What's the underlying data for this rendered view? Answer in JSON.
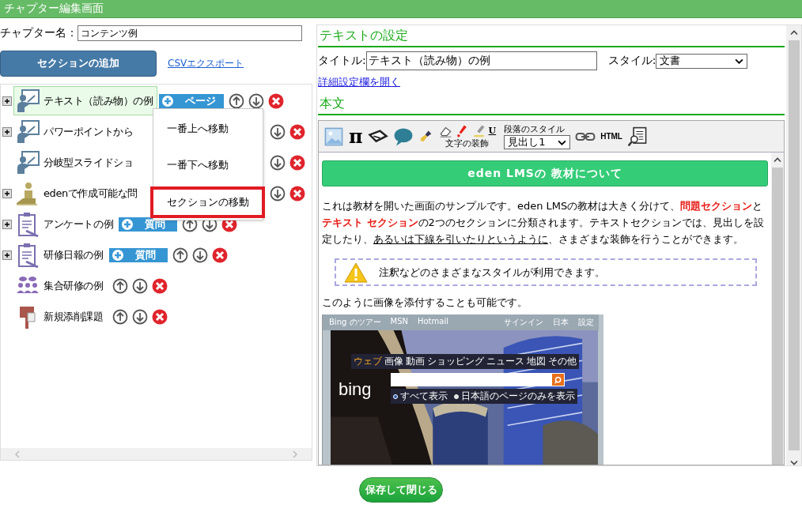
{
  "window": {
    "title": "チャプター編集画面"
  },
  "chapter_name": {
    "label": "チャプター名：",
    "value": "コンテンツ例"
  },
  "actions": {
    "add_button": "セクションの追加",
    "export_link": "CSVエクスポート"
  },
  "tree": {
    "items": [
      {
        "label": "テキスト（読み物）の例",
        "kind": "slide",
        "expandable": true,
        "selected": true,
        "covered": false,
        "add_button": "ページ"
      },
      {
        "label": "パワーポイントから",
        "kind": "slide",
        "expandable": true,
        "selected": false,
        "covered": true
      },
      {
        "label": "分岐型スライドショ",
        "kind": "slide",
        "expandable": false,
        "selected": false,
        "covered": true
      },
      {
        "label": "edenで作成可能な問",
        "kind": "quiz",
        "expandable": true,
        "selected": false,
        "covered": true
      },
      {
        "label": "アンケートの例",
        "kind": "survey",
        "expandable": true,
        "selected": false,
        "covered": false,
        "add_button": "質問"
      },
      {
        "label": "研修日報の例",
        "kind": "survey",
        "expandable": true,
        "selected": false,
        "covered": false,
        "add_button": "質問"
      },
      {
        "label": "集合研修の例",
        "kind": "group",
        "expandable": false,
        "selected": false,
        "covered": false
      },
      {
        "label": "新規添削課題",
        "kind": "post",
        "expandable": false,
        "selected": false,
        "covered": false
      }
    ]
  },
  "context_menu": {
    "items": [
      {
        "label": "一番上へ移動",
        "highlighted": false
      },
      {
        "label": "一番下へ移動",
        "highlighted": false
      },
      {
        "label": "セクションの移動",
        "highlighted": true
      }
    ]
  },
  "settings": {
    "heading": "テキストの設定",
    "title_label": "タイトル:",
    "title_value": "テキスト（読み物）の例",
    "style_label": "スタイル:",
    "style_value": "文書",
    "details_link": "詳細設定欄を開く",
    "body_heading": "本文"
  },
  "toolbar": {
    "pi_key": "π",
    "underline_key": "U",
    "decoration_label": "文字の装飾",
    "paragraph_label": "段落のスタイル",
    "paragraph_style": "見出し1",
    "html_key": "HTML"
  },
  "content": {
    "heading": "eden LMSの 教材について",
    "paragraph": [
      {
        "kind": "plain",
        "text": "これは教材を開いた画面のサンプルです。eden LMSの教材は大きく分けて、"
      },
      {
        "kind": "red",
        "text": "問題セクション"
      },
      {
        "kind": "plain",
        "text": "と"
      },
      {
        "kind": "red",
        "text": "テキスト セクション"
      },
      {
        "kind": "plain",
        "text": "の2つのセクションに分類されます。テキストセクションでは、見出しを設定したり、"
      },
      {
        "kind": "underline",
        "text": "あるいは下線を引いたりというように"
      },
      {
        "kind": "plain",
        "text": "、さまざまな装飾を行うことができます。"
      }
    ],
    "note": "注釈などのさまざまなスタイルが利用できます。",
    "image_caption": "このように画像を添付することも可能です。",
    "embedded_screenshot": {
      "links_left": [
        "Bing のツアー",
        "MSN",
        "Hotmail"
      ],
      "links_right": [
        "サインイン",
        "日本",
        "設定"
      ],
      "logo": "bing",
      "tabs": [
        {
          "label": "ウェブ",
          "selected": true
        },
        {
          "label": "画像",
          "selected": false
        },
        {
          "label": "動画",
          "selected": false
        },
        {
          "label": "ショッピング",
          "selected": false
        },
        {
          "label": "ニュース",
          "selected": false
        },
        {
          "label": "地図",
          "selected": false
        },
        {
          "label": "その他",
          "selected": false
        }
      ],
      "options": [
        {
          "label": "すべて表示",
          "selected": true
        },
        {
          "label": "日本語のページのみを表示",
          "selected": false
        }
      ]
    }
  },
  "save_button": "保存して閉じる"
}
